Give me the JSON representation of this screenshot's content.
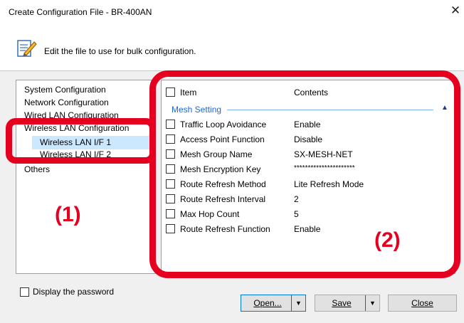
{
  "window": {
    "title": "Create Configuration File - BR-400AN",
    "close_glyph": "✕"
  },
  "header": {
    "text": "Edit the file to use for bulk configuration.",
    "icon": "edit-document-icon"
  },
  "tree": {
    "items": [
      "System Configuration",
      "Network Configuration",
      "Wired LAN Configuration",
      "Wireless LAN Configuration",
      "Wireless LAN I/F 1",
      "Wireless LAN I/F 2",
      "Others"
    ],
    "selected": "Wireless LAN I/F 1"
  },
  "list": {
    "columns": {
      "item": "Item",
      "contents": "Contents"
    },
    "group": {
      "label": "Mesh Setting",
      "chevron": "▲"
    },
    "rows": [
      {
        "item": "Traffic Loop Avoidance",
        "contents": "Enable"
      },
      {
        "item": "Access Point Function",
        "contents": "Disable"
      },
      {
        "item": "Mesh Group Name",
        "contents": "SX-MESH-NET"
      },
      {
        "item": "Mesh Encryption Key",
        "contents": "**********************"
      },
      {
        "item": "Route Refresh Method",
        "contents": "Lite Refresh Mode"
      },
      {
        "item": "Route Refresh Interval",
        "contents": "2"
      },
      {
        "item": "Max Hop Count",
        "contents": "5"
      },
      {
        "item": "Route Refresh Function",
        "contents": "Enable"
      }
    ]
  },
  "options": {
    "display_password": "Display the password"
  },
  "buttons": {
    "open": "Open...",
    "save": "Save",
    "close": "Close",
    "dropdown_arrow": "▼"
  },
  "annotations": {
    "label_1": "(1)",
    "label_2": "(2)"
  },
  "colors": {
    "annotation": "#e5001f",
    "selection": "#cce8ff",
    "group_label": "#1e67d6",
    "focus_border": "#0078d7"
  }
}
